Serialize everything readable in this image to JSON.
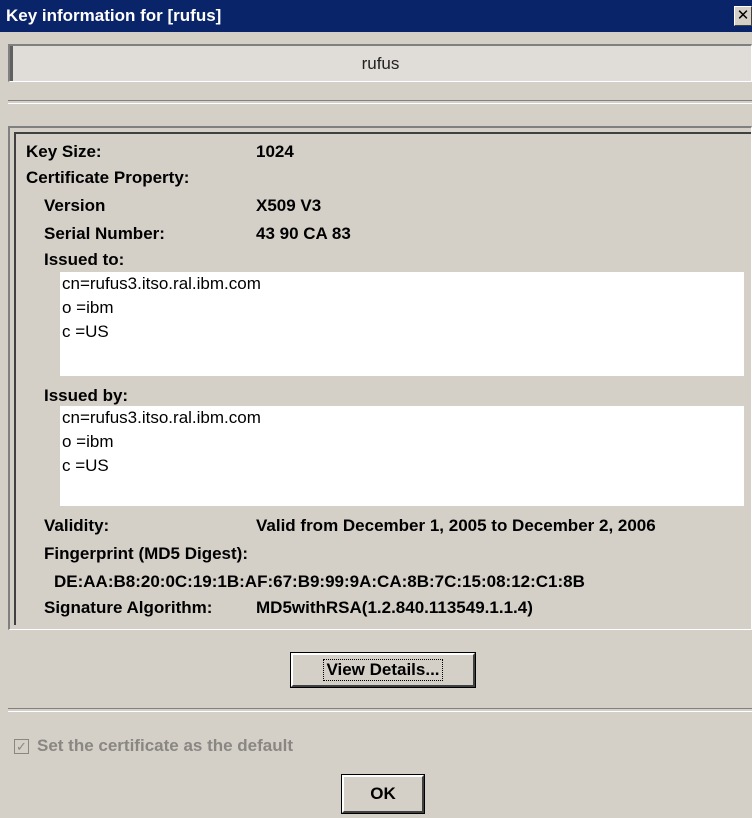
{
  "window": {
    "title": "Key information for [rufus]",
    "close_glyph": "✕"
  },
  "key_label": "rufus",
  "info": {
    "key_size_label": "Key Size:",
    "key_size_value": "1024",
    "cert_property_label": "Certificate Property:",
    "version_label": "Version",
    "version_value": "X509 V3",
    "serial_label": "Serial Number:",
    "serial_value": "43 90 CA 83",
    "issued_to_label": "Issued to:",
    "issued_to_lines": [
      "cn=rufus3.itso.ral.ibm.com",
      "o =ibm",
      "c =US"
    ],
    "issued_by_label": "Issued by:",
    "issued_by_lines": [
      "cn=rufus3.itso.ral.ibm.com",
      "o =ibm",
      "c =US"
    ],
    "validity_label": "Validity:",
    "validity_value": "Valid from December 1, 2005 to December 2, 2006",
    "fingerprint_label": "Fingerprint (MD5 Digest):",
    "fingerprint_value": "DE:AA:B8:20:0C:19:1B:AF:67:B9:99:9A:CA:8B:7C:15:08:12:C1:8B",
    "sig_alg_label": "Signature Algorithm:",
    "sig_alg_value": "MD5withRSA(1.2.840.113549.1.1.4)"
  },
  "buttons": {
    "view_details": "View Details...",
    "ok": "OK"
  },
  "default_checkbox": {
    "label": "Set the certificate as the default",
    "checked": true,
    "enabled": false,
    "check_glyph": "✓"
  },
  "colors": {
    "title_bar": "#0a246a",
    "dialog_bg": "#d4d0c8",
    "disabled_text": "#8a8783"
  }
}
